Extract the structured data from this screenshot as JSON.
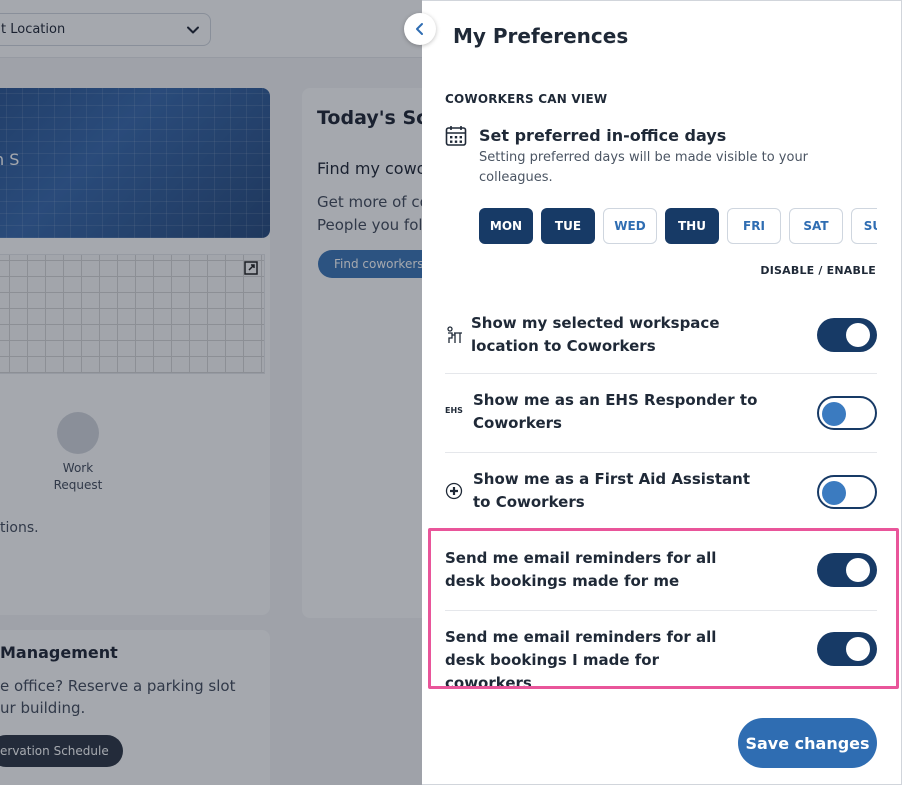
{
  "background": {
    "location_select": {
      "value": "Select Location",
      "visible_value": "t Location"
    },
    "building_card": {
      "building_name": "n S",
      "work_request_label": "Work Request",
      "actions_text": "tions."
    },
    "schedule_card": {
      "title": "Today's Sch",
      "find_title": "Find my cowo",
      "find_desc_line1": "Get more of co",
      "find_desc_line2": "People you fol",
      "find_button": "Find coworkers"
    },
    "parking_card": {
      "title": "Management",
      "desc_line1": "e office? Reserve a parking slot",
      "desc_line2": "ur building.",
      "button": "ervation Schedule"
    }
  },
  "panel": {
    "title": "My Preferences",
    "section_label": "COWORKERS CAN VIEW",
    "preferred_days": {
      "title": "Set preferred in-office days",
      "description": "Setting preferred days will be made visible to your colleagues.",
      "days": [
        {
          "label": "MON",
          "selected": true
        },
        {
          "label": "TUE",
          "selected": true
        },
        {
          "label": "WED",
          "selected": false
        },
        {
          "label": "THU",
          "selected": true
        },
        {
          "label": "FRI",
          "selected": false
        },
        {
          "label": "SAT",
          "selected": false
        },
        {
          "label": "SUN",
          "selected": false
        }
      ]
    },
    "disable_enable_label": "DISABLE / ENABLE",
    "preferences": [
      {
        "icon": "desk-person-icon",
        "text": "Show my selected workspace location to Coworkers",
        "state": "on"
      },
      {
        "icon": "ehs-icon",
        "icon_text": "EHS",
        "text": "Show me as an EHS Responder to Coworkers",
        "state": "partial"
      },
      {
        "icon": "first-aid-icon",
        "text": "Show me as a First Aid Assistant to Coworkers",
        "state": "partial"
      },
      {
        "icon": "",
        "text": "Send me email reminders for all desk bookings made for me",
        "state": "on"
      },
      {
        "icon": "",
        "text": "Send me email reminders for all desk bookings I made for coworkers",
        "state": "on"
      }
    ],
    "save_button": "Save changes"
  },
  "colors": {
    "navy": "#173a66",
    "accent_blue": "#2f6db2",
    "highlight_pink": "#e9559a"
  }
}
